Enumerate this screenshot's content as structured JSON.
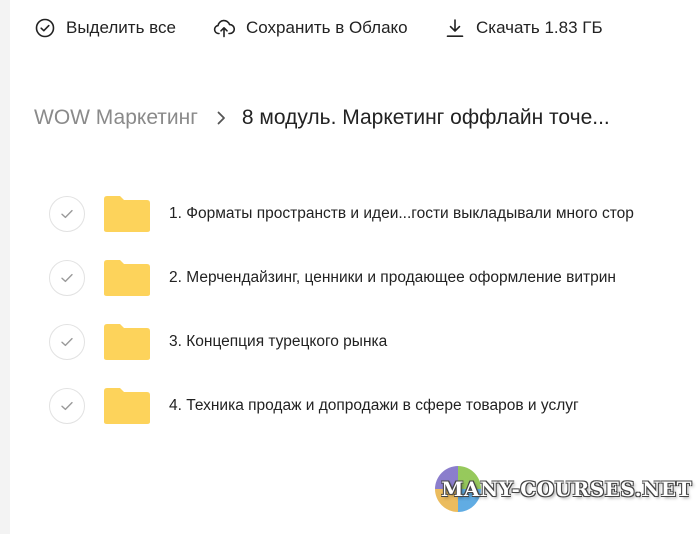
{
  "toolbar": {
    "select_all_label": "Выделить все",
    "save_cloud_label": "Сохранить в Облако",
    "download_label": "Скачать 1.83 ГБ"
  },
  "breadcrumb": {
    "parent": "WOW Маркетинг",
    "current": "8 модуль. Маркетинг оффлайн точе..."
  },
  "folders": [
    {
      "name": "1. Форматы пространств и идеи...гости выкладывали много стор"
    },
    {
      "name": "2. Мерчендайзинг, ценники и продающее оформление витрин"
    },
    {
      "name": "3. Концепция турецкого рынка"
    },
    {
      "name": "4. Техника продаж и допродажи в сфере товаров и услуг"
    }
  ],
  "watermark": {
    "text": "MANY-COURSES.NET"
  },
  "colors": {
    "folder": "#fdd35b",
    "check_border": "#e2e2e2",
    "muted_text": "#8a8a8a"
  }
}
